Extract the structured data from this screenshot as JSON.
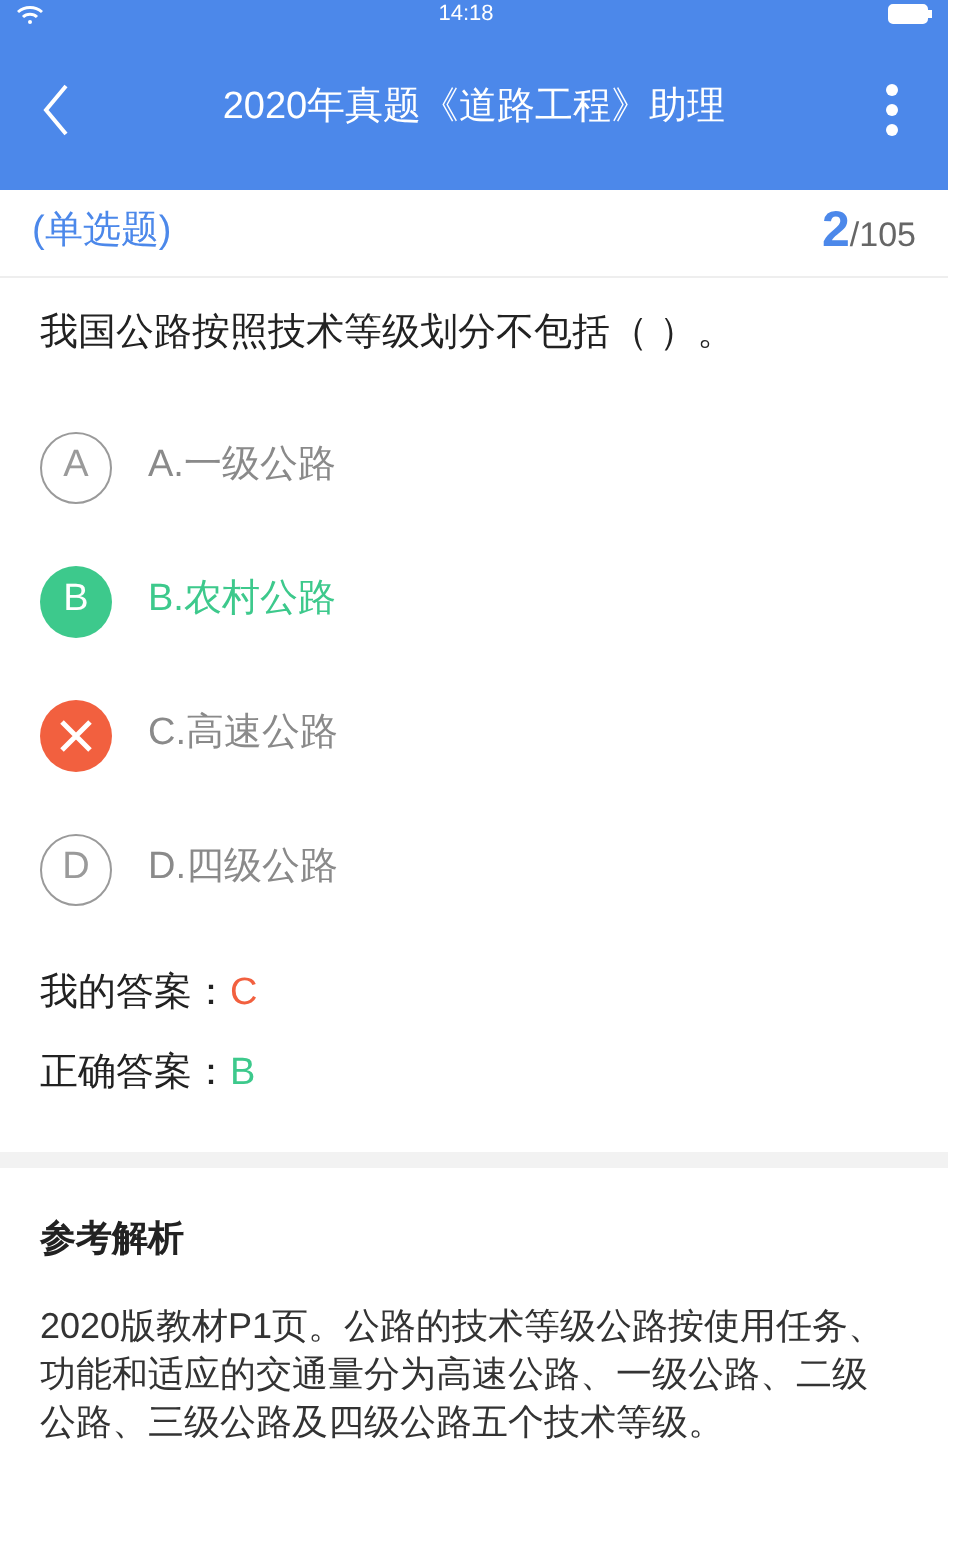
{
  "status_bar": {
    "time": "14:18"
  },
  "header": {
    "title": "2020年真题《道路工程》助理"
  },
  "question": {
    "type_label": "(单选题)",
    "number": "2",
    "total": "/105",
    "text": "我国公路按照技术等级划分不包括（ ）。"
  },
  "options": [
    {
      "letter": "A",
      "text": "A.一级公路",
      "kind": "neutral"
    },
    {
      "letter": "B",
      "text": "B.农村公路",
      "kind": "correct"
    },
    {
      "text": "C.高速公路",
      "kind": "wrong"
    },
    {
      "letter": "D",
      "text": "D.四级公路",
      "kind": "neutral"
    }
  ],
  "answers": [
    {
      "label": "我的答案：",
      "value": "C",
      "kind": "mine"
    },
    {
      "label": "正确答案：",
      "value": "B",
      "kind": "correct"
    }
  ],
  "analysis": {
    "title": "参考解析",
    "text": "2020版教材P1页。公路的技术等级公路按使用任务、功能和适应的交通量分为高速公路、一级公路、二级公路、三级公路及四级公路五个技术等级。"
  }
}
